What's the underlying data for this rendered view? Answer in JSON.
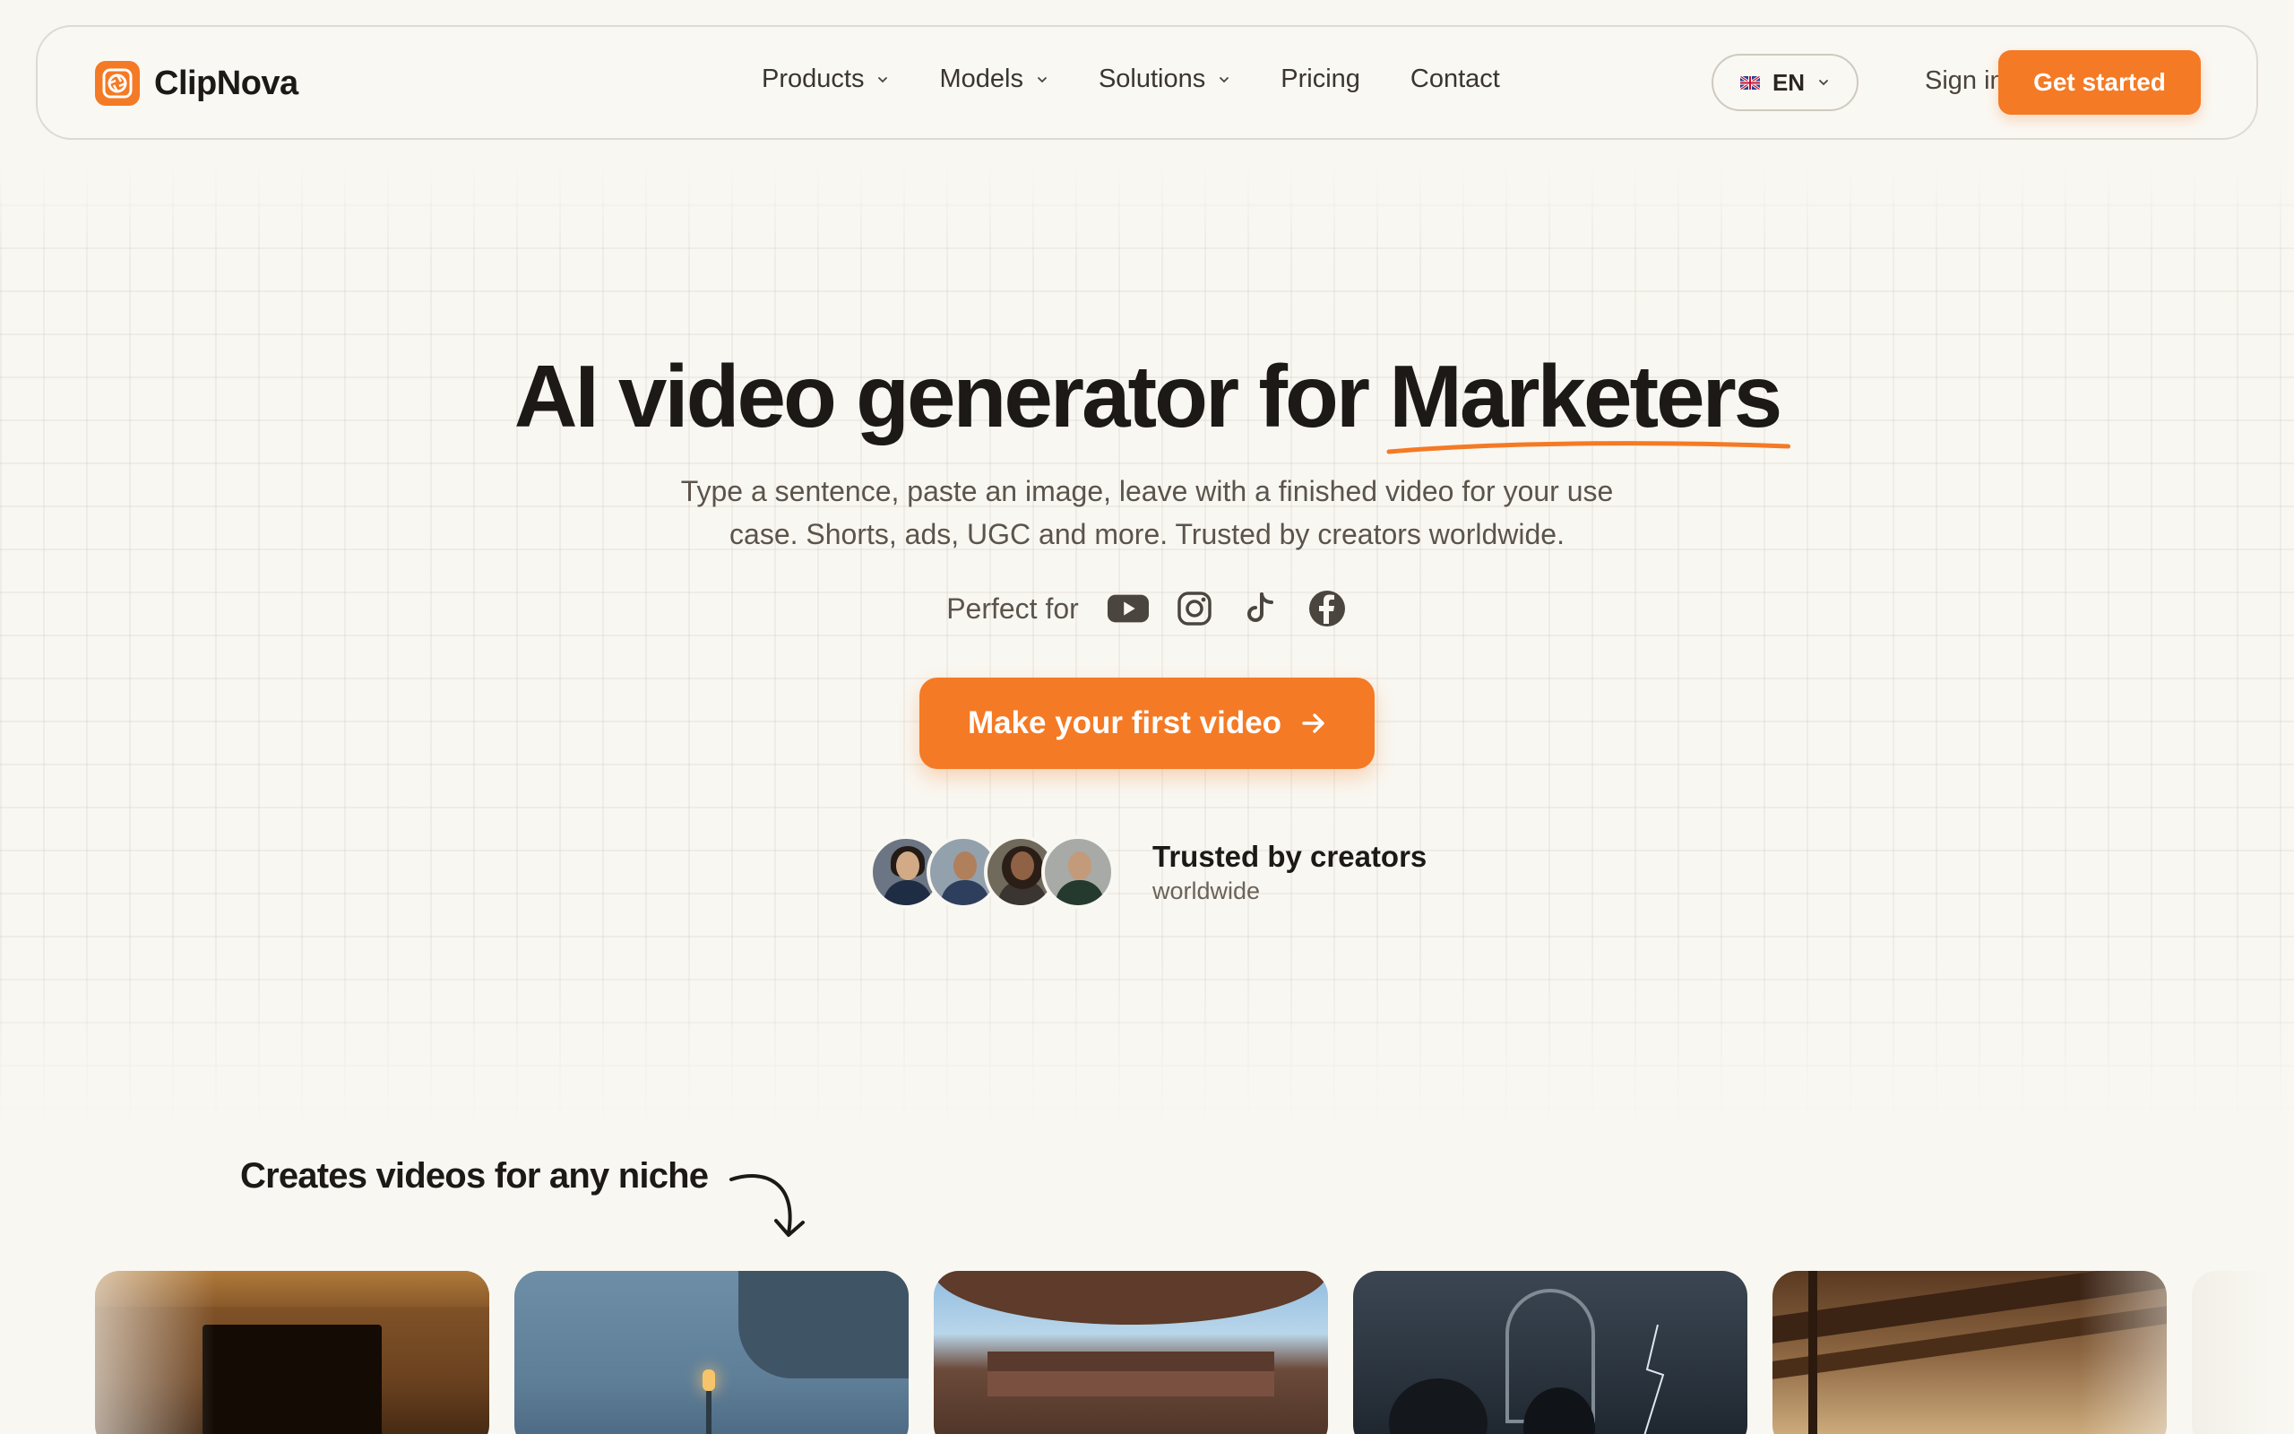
{
  "brand": {
    "name": "ClipNova",
    "accent": "#f47a25"
  },
  "nav": {
    "items": [
      {
        "label": "Products",
        "has_dropdown": true
      },
      {
        "label": "Models",
        "has_dropdown": true
      },
      {
        "label": "Solutions",
        "has_dropdown": true
      },
      {
        "label": "Pricing",
        "has_dropdown": false
      },
      {
        "label": "Contact",
        "has_dropdown": false
      }
    ],
    "language": "EN",
    "sign_in": "Sign in",
    "get_started": "Get started"
  },
  "hero": {
    "title_prefix": "AI video generator for",
    "title_highlight": "Marketers",
    "subtitle_line1": "Type a sentence, paste an image, leave with a finished video for your use",
    "subtitle_line2": "case. Shorts, ads, UGC and more. Trusted by creators worldwide.",
    "perfect_for": "Perfect for",
    "platforms": [
      "youtube-icon",
      "instagram-icon",
      "tiktok-icon",
      "facebook-icon"
    ],
    "cta": "Make your first video",
    "trust_title": "Trusted by creators",
    "trust_sub": "worldwide"
  },
  "niche": {
    "title": "Creates videos for any niche"
  }
}
